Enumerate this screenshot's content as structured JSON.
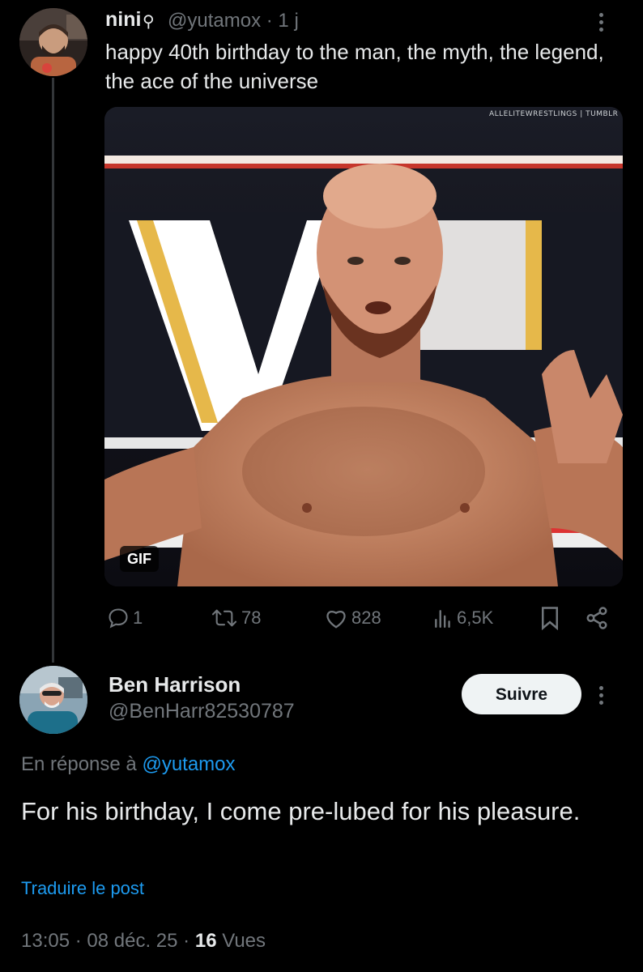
{
  "post": {
    "author_name": "nini",
    "author_symbol": "⚲",
    "handle": "@yutamox",
    "time": "1 j",
    "text": "happy 40th birthday to the man, the myth, the legend, the ace of the universe",
    "media": {
      "badge": "GIF",
      "watermark": "ALLELITEWRESTLINGS | TUMBLR"
    },
    "actions": {
      "replies": "1",
      "reposts": "78",
      "likes": "828",
      "views": "6,5K"
    }
  },
  "reply": {
    "author_name": "Ben Harrison",
    "handle": "@BenHarr82530787",
    "follow_label": "Suivre",
    "in_reply_prefix": "En réponse à",
    "in_reply_handle": "@yutamox",
    "text": "For his birthday, I come pre-lubed for his pleasure.",
    "translate_label": "Traduire le post",
    "time": "13:05",
    "date": "08 déc. 25",
    "views_count": "16",
    "views_label": "Vues"
  },
  "icons": [
    "reply-icon",
    "repost-icon",
    "like-icon",
    "views-icon",
    "bookmark-icon",
    "share-icon",
    "more-icon"
  ],
  "colors": {
    "background": "#000000",
    "text": "#e7e9ea",
    "secondary": "#71767b",
    "link": "#1d9bf0",
    "follow_bg": "#eff3f4"
  }
}
